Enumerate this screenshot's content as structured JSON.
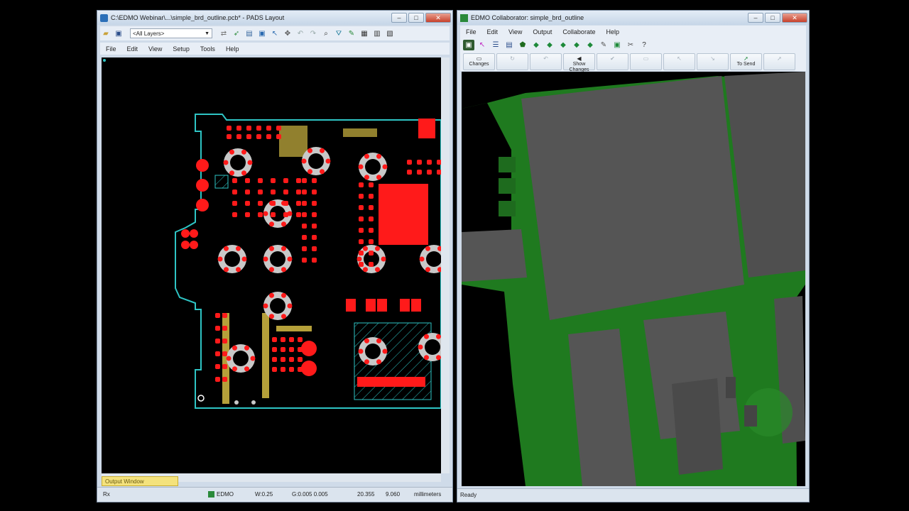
{
  "pads_window": {
    "title": "C:\\EDMO Webinar\\...\\simple_brd_outline.pcb* - PADS Layout",
    "window_controls": [
      "–",
      "□",
      "✕"
    ],
    "layer_select": "<All Layers>",
    "menus": [
      "File",
      "Edit",
      "View",
      "Setup",
      "Tools",
      "Help"
    ],
    "output_tab": "Output Window",
    "status": {
      "left": "Rx",
      "edmo": "EDMO",
      "width": "W:0.25",
      "grid": "G:0.005 0.005",
      "x": "20.355",
      "y": "9.060",
      "units": "millimeters"
    }
  },
  "edmo_window": {
    "title": "EDMO Collaborator: simple_brd_outline",
    "window_controls": [
      "–",
      "□",
      "✕"
    ],
    "menus": [
      "File",
      "Edit",
      "View",
      "Output",
      "Collaborate",
      "Help"
    ],
    "buttons": [
      {
        "label": "Changes",
        "enabled": true
      },
      {
        "label": "",
        "enabled": false
      },
      {
        "label": "",
        "enabled": false
      },
      {
        "label": "Show\nChanges",
        "enabled": true
      },
      {
        "label": "",
        "enabled": false
      },
      {
        "label": "",
        "enabled": false
      },
      {
        "label": "",
        "enabled": false
      },
      {
        "label": "",
        "enabled": false
      },
      {
        "label": "To Send",
        "enabled": true
      },
      {
        "label": "",
        "enabled": false
      }
    ],
    "status": "Ready"
  },
  "colors": {
    "board_outline": "#2ec4c4",
    "copper": "#ff1a1a",
    "pad_white": "#c8c8c8",
    "silk_olive": "#b5a03a",
    "board_green": "#1f7a1f",
    "component_gray": "#555555"
  }
}
